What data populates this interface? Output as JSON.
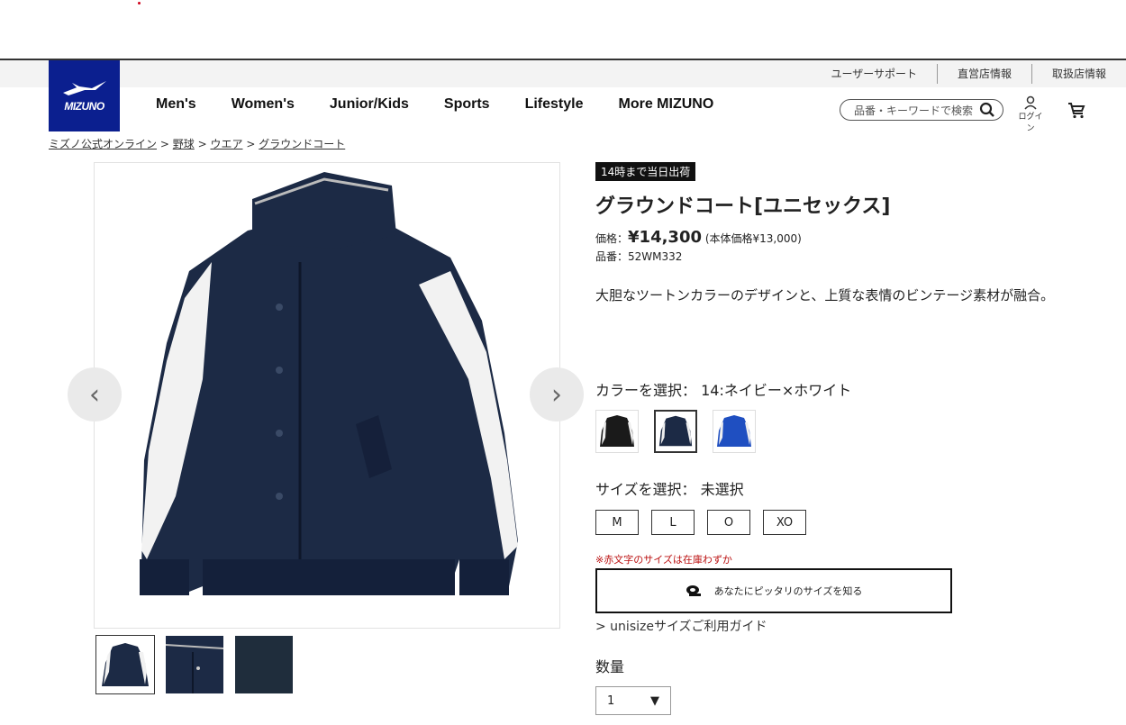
{
  "topbar": {
    "links": [
      "ユーザーサポート",
      "直営店情報",
      "取扱店情報"
    ]
  },
  "logo": {
    "text": "MIZUNO",
    "color": "#0b1f8f"
  },
  "nav": {
    "items": [
      "Men's",
      "Women's",
      "Junior/Kids",
      "Sports",
      "Lifestyle",
      "More MIZUNO"
    ]
  },
  "search": {
    "placeholder": "品番・キーワードで検索"
  },
  "login": {
    "label": "ログイン"
  },
  "breadcrumb": {
    "items": [
      "ミズノ公式オンライン",
      "野球",
      "ウエア",
      "グラウンドコート"
    ],
    "separator": ">"
  },
  "gallery": {
    "prev_icon": "chevron-left-icon",
    "next_icon": "chevron-right-icon",
    "thumbnails": 3
  },
  "product": {
    "badge": "14時まで当日出荷",
    "title": "グラウンドコート[ユニセックス]",
    "price_label": "価格：",
    "price": "¥14,300",
    "price_note": "(本体価格¥13,000)",
    "sku_label": "品番：",
    "sku": "52WM332",
    "description": "大胆なツートンカラーのデザインと、上質な表情のビンテージ素材が融合。",
    "color_label": "カラーを選択：",
    "color_value": "14:ネイビー×ホワイト",
    "size_label": "サイズを選択：",
    "size_value": "未選択",
    "sizes": [
      "M",
      "L",
      "O",
      "XO"
    ],
    "size_note": "※赤文字のサイズは在庫わずか",
    "fit_button": "あなたにピッタリのサイズを知る",
    "guide_link": "> unisizeサイズご利用ガイド",
    "qty_label": "数量",
    "qty_value": "1"
  }
}
